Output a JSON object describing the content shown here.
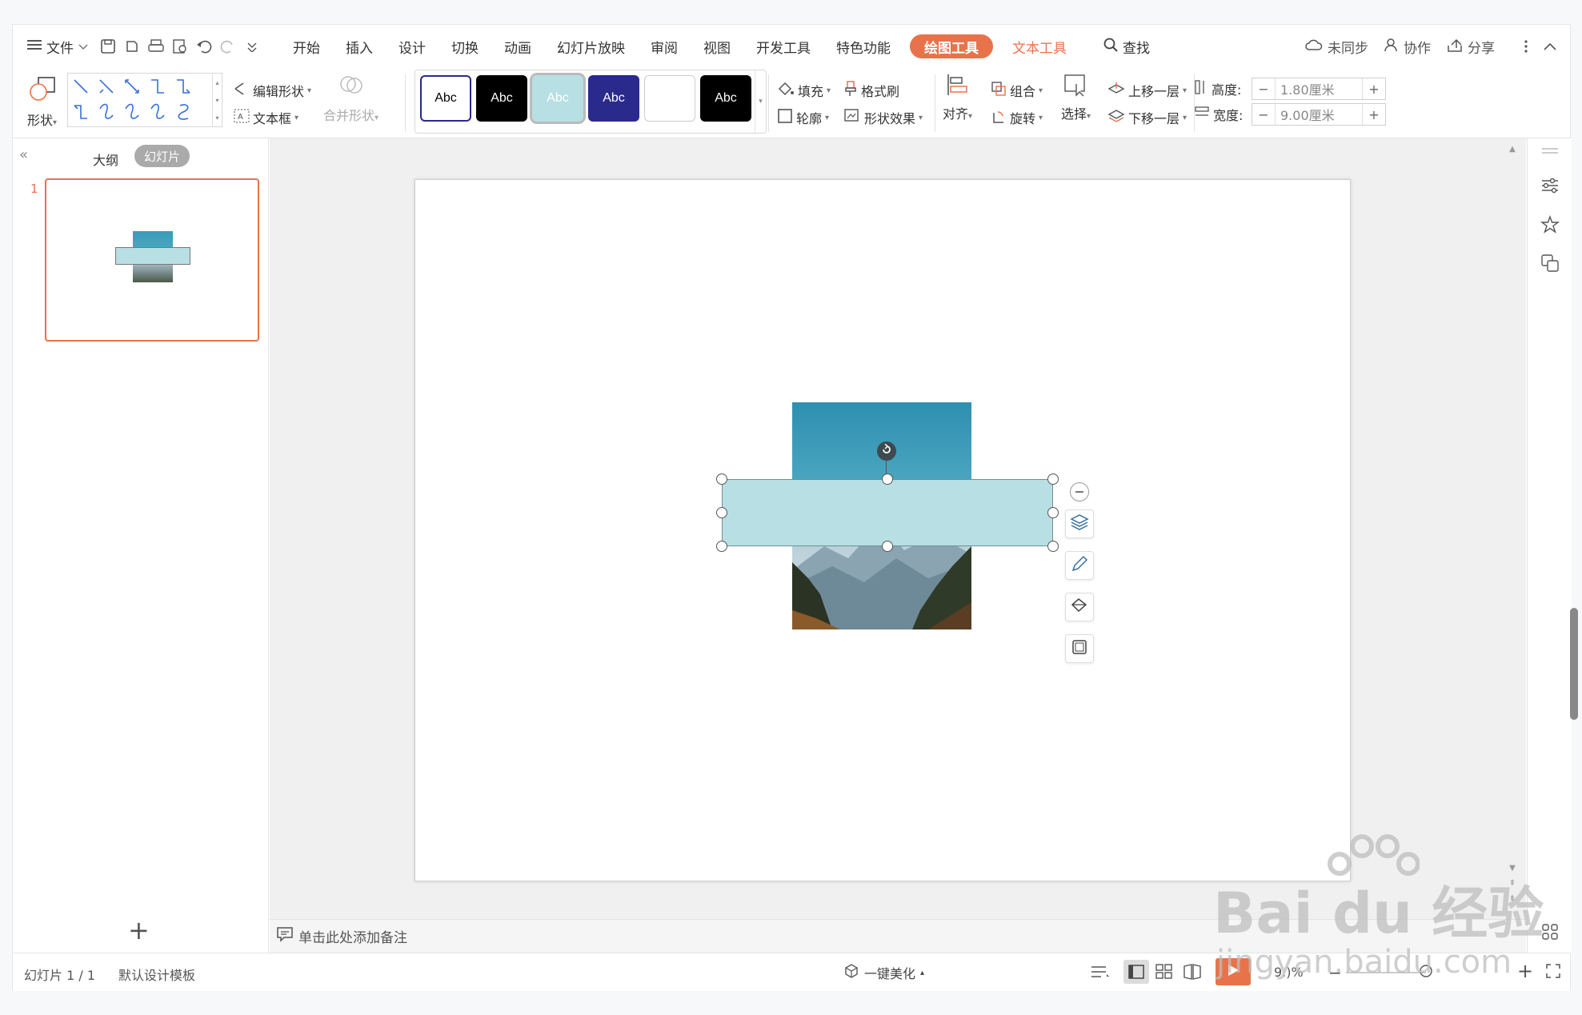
{
  "menubar": {
    "file_label": "文件",
    "tabs": [
      "开始",
      "插入",
      "设计",
      "切换",
      "动画",
      "幻灯片放映",
      "审阅",
      "视图",
      "开发工具",
      "特色功能"
    ],
    "active_tab": "绘图工具",
    "text_tools_tab": "文本工具",
    "search_label": "查找",
    "sync_label": "未同步",
    "collab_label": "协作",
    "share_label": "分享"
  },
  "ribbon": {
    "shape_label": "形状",
    "edit_shape_label": "编辑形状",
    "textbox_label": "文本框",
    "merge_shape_label": "合并形状",
    "style_label": "Abc",
    "fill_label": "填充",
    "format_brush_label": "格式刷",
    "outline_label": "轮廓",
    "shape_effect_label": "形状效果",
    "align_label": "对齐",
    "group_label": "组合",
    "rotate_label": "旋转",
    "select_label": "选择",
    "bring_forward_label": "上移一层",
    "send_backward_label": "下移一层",
    "height_label": "高度:",
    "height_value": "1.80厘米",
    "width_label": "宽度:",
    "width_value": "9.00厘米"
  },
  "leftpanel": {
    "outline_tab": "大纲",
    "slides_tab": "幻灯片",
    "slide_number": "1"
  },
  "notes_placeholder": "单击此处添加备注",
  "statusbar": {
    "slide_info": "幻灯片 1 / 1",
    "template": "默认设计模板",
    "beautify": "一键美化",
    "zoom": "9.)%"
  },
  "watermark": {
    "logo": "Bai du 经验",
    "url": "jingyan.baidu.com"
  },
  "colors": {
    "accent": "#e8734a",
    "shape_fill": "#b8dfe3",
    "style_navy": "#2a2a8c"
  }
}
